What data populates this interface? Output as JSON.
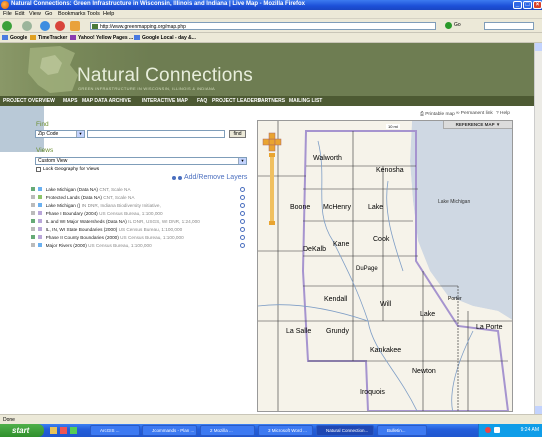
{
  "window": {
    "title": "Natural Connections: Green Infrastructure in Wisconsin, Illinois and Indiana | Live Map - Mozilla Firefox"
  },
  "menu": [
    "File",
    "Edit",
    "View",
    "Go",
    "Bookmarks",
    "Tools",
    "Help"
  ],
  "nav": {
    "url": "http://www.greenmapping.org/map.php",
    "go_label": "Go"
  },
  "bookmarks": [
    "Google",
    "TimeTracker",
    "Yahoo! Yellow Pages ...",
    "Google Local - day &..."
  ],
  "site": {
    "title": "Natural Connections",
    "subtitle": "GREEN INFRASTRUCTURE IN WISCONSIN, ILLINOIS & INDIANA",
    "nav": [
      "PROJECT OVERVIEW",
      "MAPS",
      "MAP DATA ARCHIVE",
      "INTERACTIVE MAP",
      "FAQ",
      "PROJECT LEADERS",
      "PARTNERS",
      "MAILING LIST"
    ]
  },
  "tools": {
    "print": "Printable map",
    "permalink": "Permanent link",
    "help": "Help"
  },
  "find": {
    "label": "Find",
    "select_value": "Zip Code",
    "button": "find"
  },
  "views": {
    "label": "Views",
    "select_value": "Custom View",
    "lock_label": "Lock Geography for Views"
  },
  "add_remove": "Add/Remove Layers",
  "layers": [
    {
      "name": "Lake Michigan (Data NA)",
      "source": "CNT, Scale NA"
    },
    {
      "name": "Protected Lands (Data NA)",
      "source": "CNT, Scale NA"
    },
    {
      "name": "Lake Michigan ()",
      "source": "IN DNR, Indiana Biodiversity Initiative,"
    },
    {
      "name": "Phase I Boundary (2004)",
      "source": "US Census Bureau, 1:100,000"
    },
    {
      "name": "IL and WI Major Watersheds (Data NA)",
      "source": "IL DNR, USGS, WI DNR, 1:24,000"
    },
    {
      "name": "IL, IN, WI State Boundaries (2000)",
      "source": "US Census Bureau, 1:100,000"
    },
    {
      "name": "Phase II County Boundaries (2000)",
      "source": "US Census Bureau, 1:100,000"
    },
    {
      "name": "Major Rivers (2000)",
      "source": "US Census Bureau, 1:100,000"
    }
  ],
  "map": {
    "ref_button": "REFERENCE MAP",
    "labels": [
      "Walworth",
      "Kenosha",
      "Boone",
      "McHenry",
      "Lake",
      "Lake Michigan",
      "DeKalb",
      "Kane",
      "Cook",
      "DuPage",
      "Kendall",
      "Will",
      "Lake",
      "La Porte",
      "La Salle",
      "Grundy",
      "Kankakee",
      "Newton",
      "Iroquois",
      "Porter"
    ],
    "scale_label": "10 mi"
  },
  "status": {
    "text": "Done"
  },
  "taskbar": {
    "start": "start",
    "tasks": [
      "ArcGIS ...",
      "Jcommands - Plan ...",
      "2 Mozilla ...",
      "3 Microsoft Word ...",
      "Natural Connection...",
      "Bulletin..."
    ],
    "clock": "9:24 AM"
  }
}
